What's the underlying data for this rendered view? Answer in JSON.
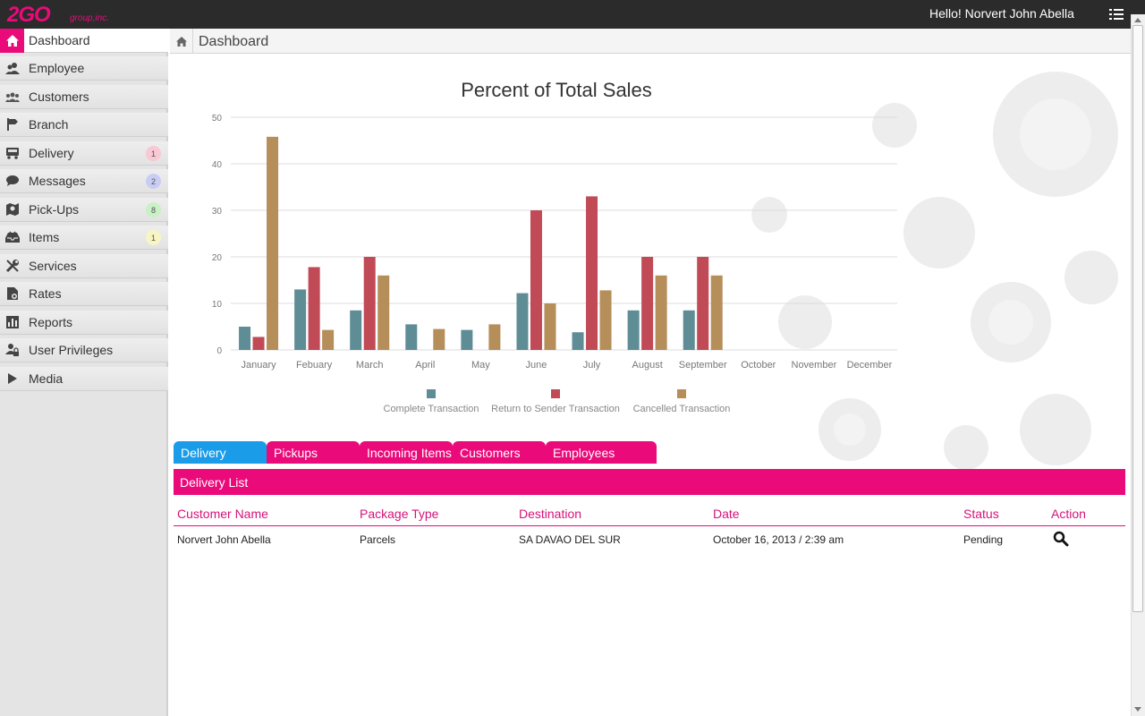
{
  "brand": {
    "logo_main": "2GO",
    "logo_sub": "group,inc.",
    "color": "#ea0a7a"
  },
  "header": {
    "greeting": "Hello! Norvert John Abella",
    "menu_icon": "list-icon"
  },
  "sidebar": {
    "items": [
      {
        "label": "Dashboard",
        "icon": "home-icon",
        "active": true
      },
      {
        "label": "Employee",
        "icon": "users-icon"
      },
      {
        "label": "Customers",
        "icon": "group-icon"
      },
      {
        "label": "Branch",
        "icon": "branch-icon"
      },
      {
        "label": "Delivery",
        "icon": "truck-icon",
        "badge": "1",
        "badge_color": "#f8c8d4"
      },
      {
        "label": "Messages",
        "icon": "chat-icon",
        "badge": "2",
        "badge_color": "#c9cdf4"
      },
      {
        "label": "Pick-Ups",
        "icon": "map-icon",
        "badge": "8",
        "badge_color": "#c9f0c6"
      },
      {
        "label": "Items",
        "icon": "tray-icon",
        "badge": "1",
        "badge_color": "#f8f5c4"
      },
      {
        "label": "Services",
        "icon": "tools-icon"
      },
      {
        "label": "Rates",
        "icon": "calc-icon"
      },
      {
        "label": "Reports",
        "icon": "bar-chart-icon"
      },
      {
        "label": "User Privileges",
        "icon": "user-lock-icon"
      },
      {
        "label": "Media",
        "icon": "play-icon"
      }
    ]
  },
  "breadcrumb": {
    "title": "Dashboard"
  },
  "chart_data": {
    "type": "bar",
    "title": "Percent of Total Sales",
    "categories": [
      "January",
      "Febuary",
      "March",
      "April",
      "May",
      "June",
      "July",
      "August",
      "September",
      "October",
      "November",
      "December"
    ],
    "series": [
      {
        "name": "Complete Transaction",
        "color": "#5e8d96",
        "values": [
          5,
          13,
          8.5,
          5.5,
          4.3,
          12.2,
          3.8,
          8.5,
          8.5,
          null,
          null,
          null
        ]
      },
      {
        "name": "Return to Sender Transaction",
        "color": "#c14a57",
        "values": [
          2.8,
          17.8,
          20,
          null,
          null,
          30,
          33,
          20,
          20,
          null,
          null,
          null
        ]
      },
      {
        "name": "Cancelled Transaction",
        "color": "#b58e5a",
        "values": [
          45.8,
          4.3,
          16,
          4.5,
          5.5,
          10,
          12.8,
          16,
          16,
          null,
          null,
          null
        ]
      }
    ],
    "yticks": [
      0,
      10,
      20,
      30,
      40,
      50
    ],
    "ylim": [
      0,
      50
    ],
    "grid": true,
    "legend_position": "bottom"
  },
  "tabs": [
    {
      "label": "Delivery",
      "active": true
    },
    {
      "label": "Pickups"
    },
    {
      "label": "Incoming Items"
    },
    {
      "label": "Customers"
    },
    {
      "label": "Employees"
    }
  ],
  "list": {
    "title": "Delivery List",
    "columns": [
      "Customer Name",
      "Package Type",
      "Destination",
      "Date",
      "Status",
      "Action"
    ],
    "rows": [
      {
        "customer": "Norvert John Abella",
        "package": "Parcels",
        "destination": "SA DAVAO DEL SUR",
        "date": "October 16, 2013 / 2:39 am",
        "status": "Pending",
        "action_icon": "search-icon"
      }
    ]
  }
}
